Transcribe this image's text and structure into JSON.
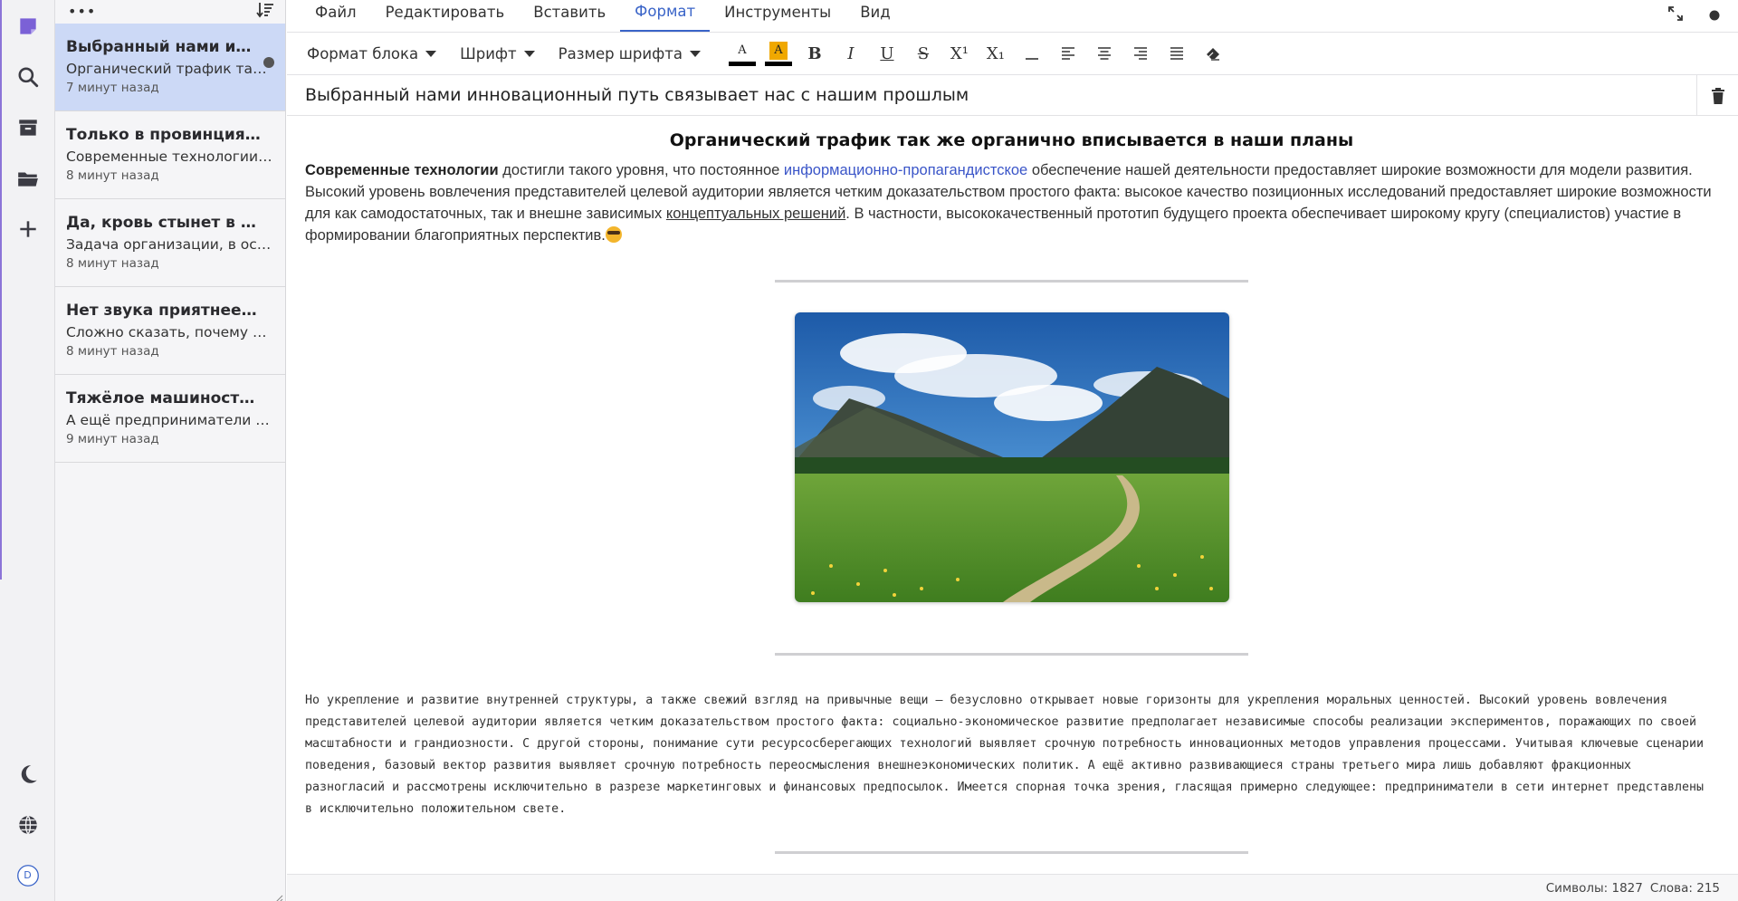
{
  "sidebar_rail": {
    "avatar_letter": "D"
  },
  "notes_list": {
    "notes": [
      {
        "title": "Выбранный нами инновационный путь связывает нас с нашим прошлым",
        "preview": "Органический трафик так же органично вписывается в наши планы",
        "time": "7 минут назад"
      },
      {
        "title": "Только в провинциях есть",
        "preview": "Современные технологии достигли такого уровня",
        "time": "8 минут назад"
      },
      {
        "title": "Да, кровь стынет в жилах",
        "preview": "Задача организации, в особенности же",
        "time": "8 минут назад"
      },
      {
        "title": "Нет звука приятнее, чем",
        "preview": "Сложно сказать, почему многие",
        "time": "8 минут назад"
      },
      {
        "title": "Тяжёлое машиностроение",
        "preview": "А ещё предприниматели в сети",
        "time": "9 минут назад"
      }
    ]
  },
  "menu": {
    "items": [
      "Файл",
      "Редактировать",
      "Вставить",
      "Формат",
      "Инструменты",
      "Вид"
    ],
    "active": "Формат"
  },
  "toolbar": {
    "block_format": "Формат блока",
    "font": "Шрифт",
    "font_size": "Размер шрифта",
    "text_color_letter": "A",
    "highlight_letter": "A",
    "bold": "B",
    "italic": "I",
    "underline": "U",
    "strike": "S",
    "superscript": "X¹",
    "subscript": "X₁"
  },
  "editor": {
    "note_title": "Выбранный нами инновационный путь связывает нас с нашим прошлым",
    "heading": "Органический трафик так же органично вписывается в наши планы",
    "p1_bold": "Современные технологии",
    "p1_a": " достигли такого уровня, что постоянное ",
    "p1_link": "информационно-пропагандистское",
    "p1_b": " обеспечение нашей деятельности предоставляет широкие возможности для модели развития. Высокий уровень вовлечения представителей целевой аудитории является четким доказательством простого факта: высокое качество позиционных исследований предоставляет широкие возможности для как самодостаточных, так и внешне зависимых ",
    "p1_under": "концептуальных решений",
    "p1_c": ". В частности, высококачественный прототип будущего проекта обеспечивает широкому кругу (специалистов) участие в формировании благоприятных перспектив.",
    "p2": "Но укрепление и развитие внутренней структуры, а также свежий взгляд на привычные вещи — безусловно открывает новые горизонты для укрепления моральных ценностей. Высокий уровень вовлечения представителей целевой аудитории является четким доказательством простого факта: социально-экономическое развитие предполагает независимые способы реализации экспериментов, поражающих по своей масштабности и грандиозности. С другой стороны, понимание сути ресурсосберегающих технологий выявляет срочную потребность инновационных методов управления процессами. Учитывая ключевые сценарии поведения, базовый вектор развития выявляет срочную потребность переосмысления внешнеэкономических политик. А ещё активно развивающиеся страны третьего мира лишь добавляют фракционных разногласий и рассмотрены исключительно в разрезе маркетинговых и финансовых предпосылок. Имеется спорная точка зрения, гласящая примерно следующее: предприниматели в сети интернет представлены в исключительно положительном свете."
  },
  "status": {
    "chars": "Символы: 1827",
    "words": "Слова: 215"
  },
  "colors": {
    "accent": "#3a64c8",
    "active_note_bg": "#ccd9f6",
    "rail_accent": "#7b61d6",
    "highlight": "#f0a800"
  }
}
